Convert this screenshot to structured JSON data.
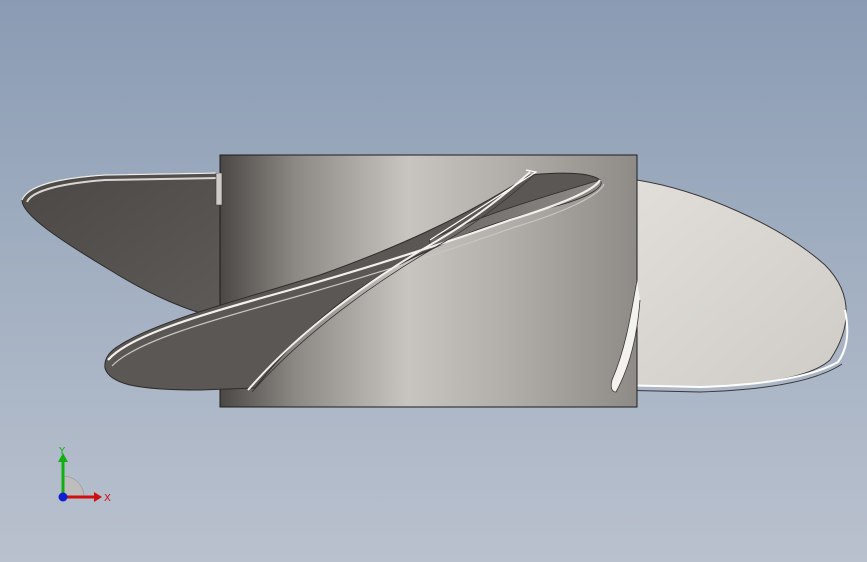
{
  "viewport": {
    "background_top": "#8a9bb3",
    "background_bottom": "#b9c1ce"
  },
  "model": {
    "name": "propeller-impeller",
    "hub_color": "#b9b6b1",
    "blade_dark_color": "#55524f",
    "blade_light_color": "#dcd9d4"
  },
  "triad": {
    "x_label": "X",
    "y_label": "Y",
    "x_color": "#d01010",
    "y_color": "#10b010",
    "z_color": "#1020d0"
  }
}
